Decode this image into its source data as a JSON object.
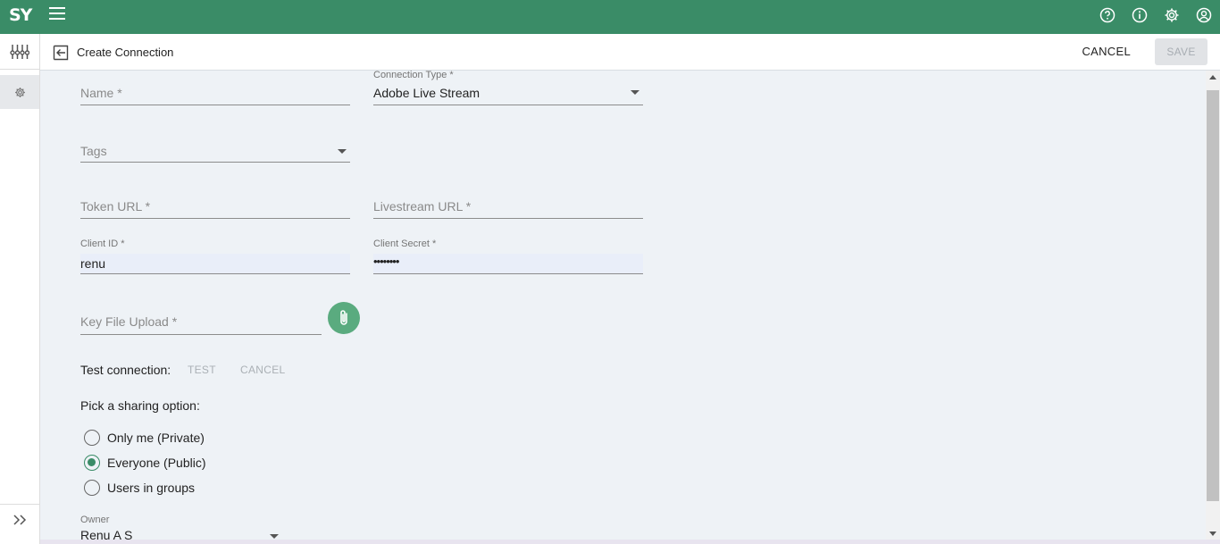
{
  "app": {
    "logo_text": "SY",
    "accent": "#3a8c67"
  },
  "topbar": {
    "icons": [
      "help-circle-icon",
      "info-icon",
      "gear-icon",
      "account-icon"
    ]
  },
  "header": {
    "title": "Create Connection",
    "cancel_label": "CANCEL",
    "save_label": "SAVE"
  },
  "form": {
    "name": {
      "placeholder": "Name *",
      "value": ""
    },
    "connection_type": {
      "label": "Connection Type *",
      "value": "Adobe Live Stream"
    },
    "tags": {
      "placeholder": "Tags"
    },
    "token_url": {
      "placeholder": "Token URL *"
    },
    "livestream_url": {
      "placeholder": "Livestream URL *"
    },
    "client_id": {
      "label": "Client ID *",
      "value": "renu"
    },
    "client_secret": {
      "label": "Client Secret *",
      "value": "••••••••"
    },
    "key_file": {
      "placeholder": "Key File Upload *"
    },
    "test_connection": {
      "label": "Test connection:",
      "test_label": "TEST",
      "cancel_label": "CANCEL"
    },
    "sharing": {
      "label": "Pick a sharing option:",
      "options": [
        {
          "label": "Only me (Private)",
          "selected": false
        },
        {
          "label": "Everyone (Public)",
          "selected": true
        },
        {
          "label": "Users in groups",
          "selected": false
        }
      ]
    },
    "owner": {
      "label": "Owner",
      "value": "Renu A S"
    }
  }
}
